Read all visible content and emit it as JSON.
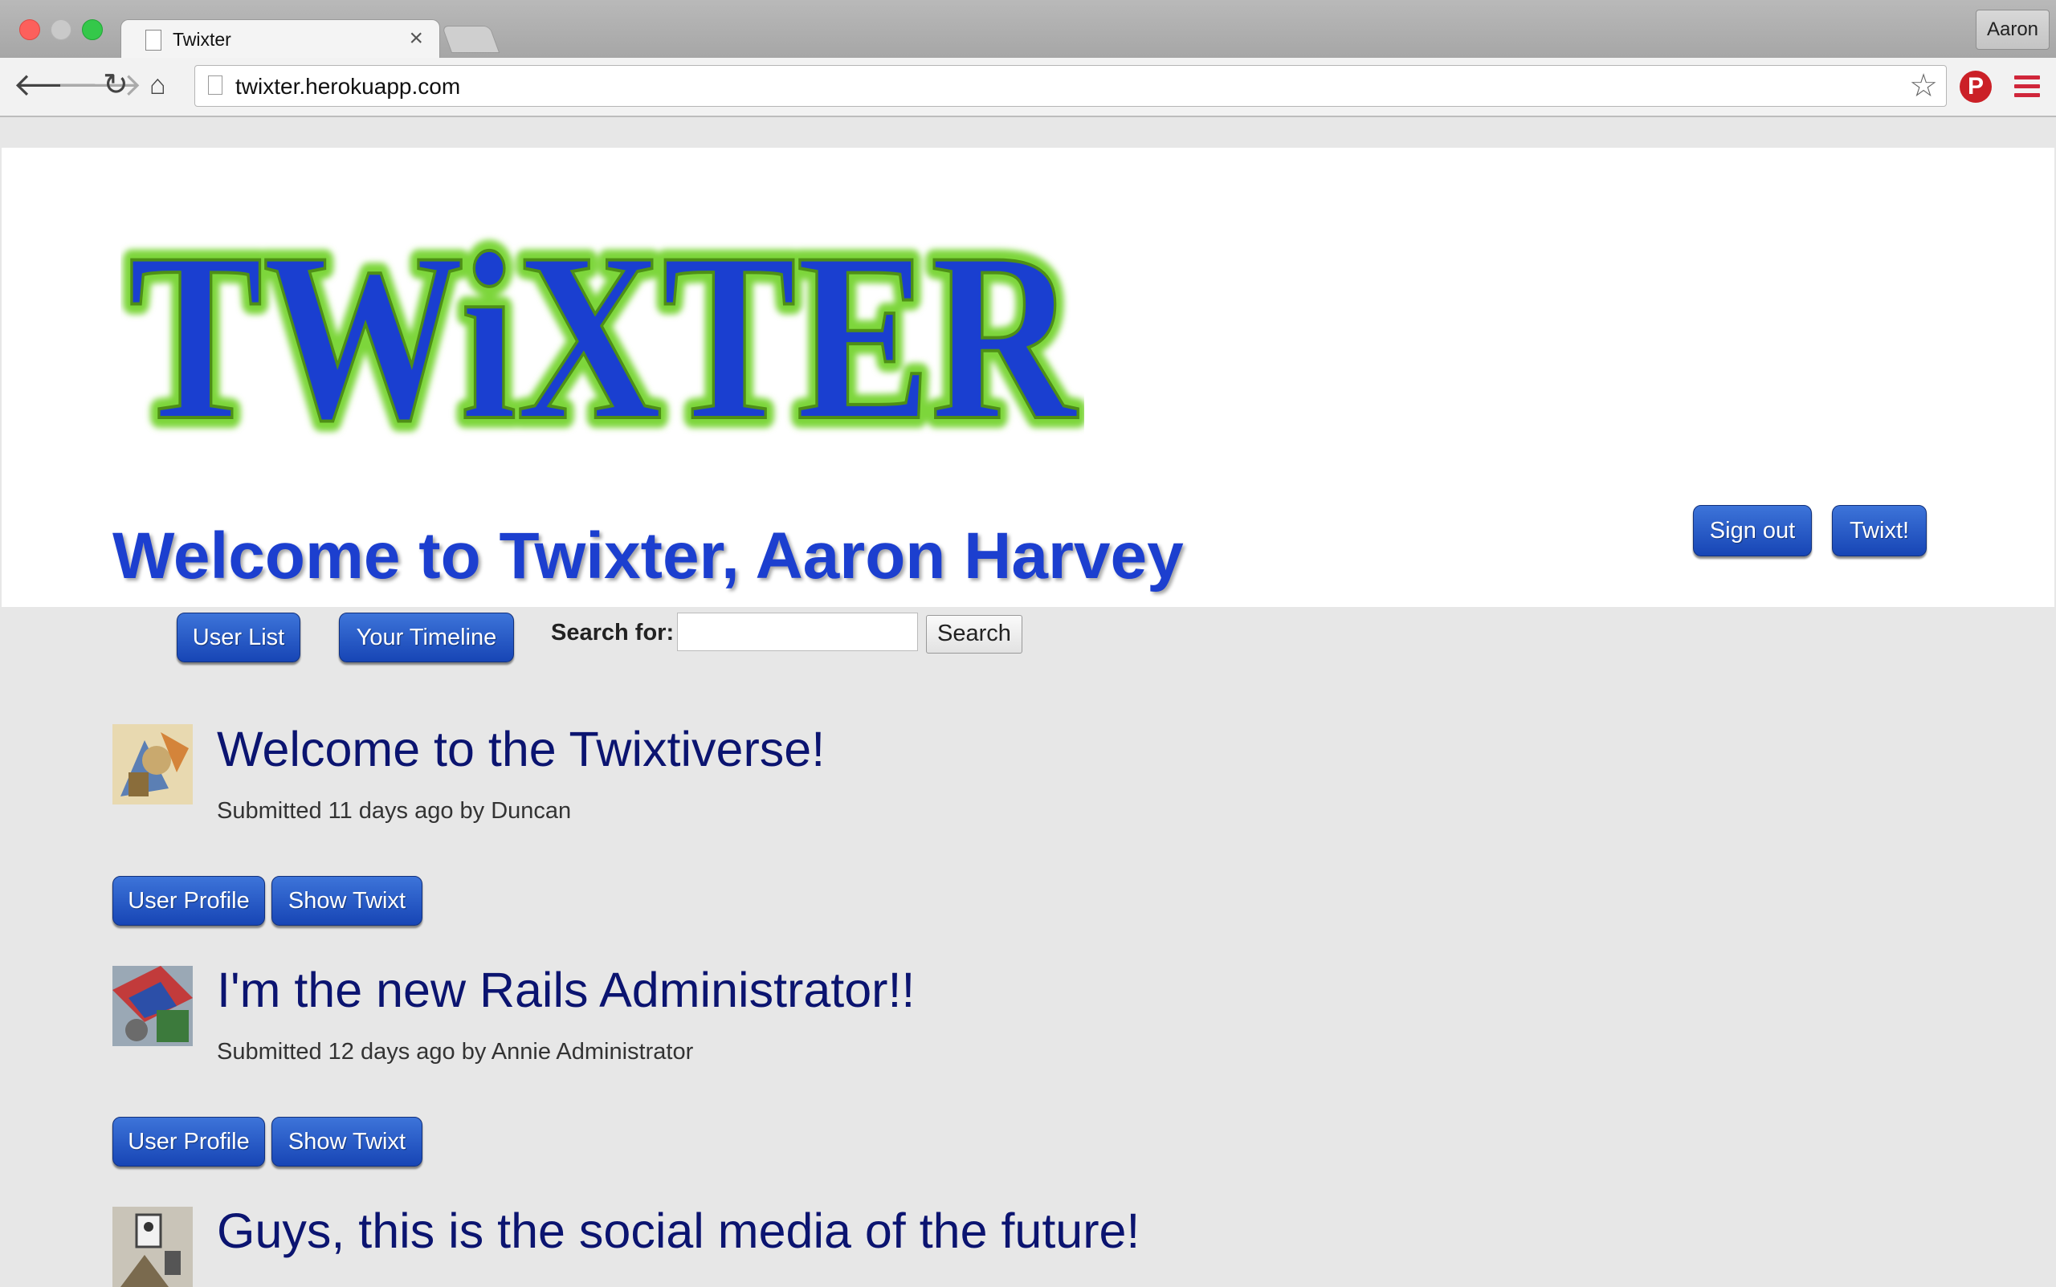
{
  "browser": {
    "tab_title": "Twixter",
    "url": "twixter.herokuapp.com",
    "profile_name": "Aaron"
  },
  "header": {
    "logo_text": "TWiXTER",
    "welcome": "Welcome to Twixter, Aaron Harvey",
    "sign_out_label": "Sign out",
    "twixt_label": "Twixt!"
  },
  "nav": {
    "user_list_label": "User List",
    "timeline_label": "Your Timeline",
    "search_label": "Search for:",
    "search_value": "",
    "search_button_label": "Search"
  },
  "posts": [
    {
      "title": "Welcome to the Twixtiverse!",
      "meta": "Submitted 11 days ago by Duncan",
      "profile_label": "User Profile",
      "show_label": "Show Twixt"
    },
    {
      "title": "I'm the new Rails Administrator!!",
      "meta": "Submitted 12 days ago by Annie Administrator",
      "profile_label": "User Profile",
      "show_label": "Show Twixt"
    },
    {
      "title": "Guys, this is the social media of the future!"
    }
  ],
  "colors": {
    "button_blue": "#1f4fc4",
    "welcome_blue": "#1c3fcf",
    "post_title_navy": "#0b1470",
    "logo_blue": "#1a3fd0",
    "logo_green": "#7dd63a"
  }
}
